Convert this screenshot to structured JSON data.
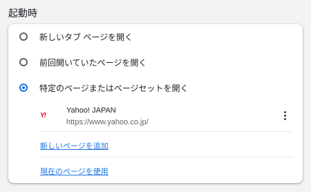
{
  "section": {
    "title": "起動時"
  },
  "options": [
    {
      "label": "新しいタブ ページを開く",
      "selected": false
    },
    {
      "label": "前回開いていたページを開く",
      "selected": false
    },
    {
      "label": "特定のページまたはページセットを開く",
      "selected": true
    }
  ],
  "pages": [
    {
      "title": "Yahoo! JAPAN",
      "url": "https://www.yahoo.co.jp/",
      "favicon": "Y!"
    }
  ],
  "actions": {
    "add_page": "新しいページを追加",
    "use_current": "現在のページを使用"
  },
  "colors": {
    "accent": "#1a73e8",
    "favicon": "#ff0033"
  }
}
